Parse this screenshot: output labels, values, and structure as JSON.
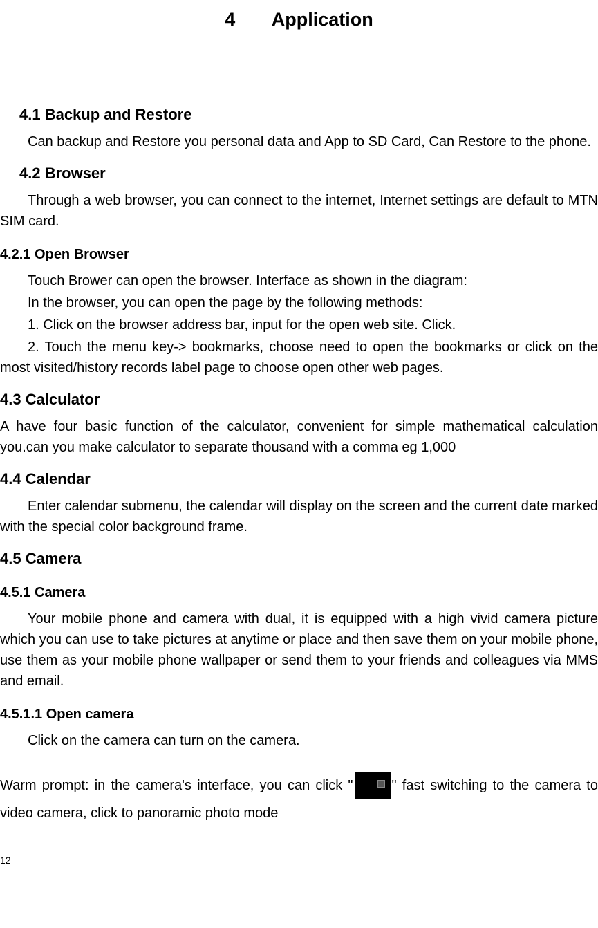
{
  "chapter": {
    "number": "4",
    "title": "Application"
  },
  "sections": {
    "s41": {
      "heading": "4.1    Backup and Restore",
      "body": "Can backup and Restore you personal data and App to SD Card, Can Restore to the phone."
    },
    "s42": {
      "heading": "4.2       Browser",
      "body": "Through a web browser, you can connect to the internet, Internet settings are default to MTN SIM card."
    },
    "s421": {
      "heading": "4.2.1    Open Browser",
      "p1": "Touch Brower can open the browser. Interface as shown in the diagram:",
      "p2": "In the browser, you can open the page by the following methods:",
      "p3": "1. Click on the browser address bar, input for the open web site. Click.",
      "p4": "2. Touch the menu key-> bookmarks, choose need to open the bookmarks or click on the most visited/history records label page to choose open other web pages."
    },
    "s43": {
      "heading": "4.3   Calculator",
      "body": "A have four basic function of the calculator, convenient for simple mathematical calculation you.can you make calculator to separate thousand with a comma eg 1,000"
    },
    "s44": {
      "heading": "4.4   Calendar",
      "body": "Enter calendar submenu, the calendar will display on the screen and the current date marked with the special color background frame."
    },
    "s45": {
      "heading": "4.5   Camera"
    },
    "s451": {
      "heading": "4.5.1    Camera",
      "body": "Your mobile phone and camera with dual, it is equipped with a high vivid camera picture which you can use to take pictures at anytime or place and then save them on your mobile phone, use them as your mobile phone wallpaper or send them to your friends and colleagues via MMS and email."
    },
    "s4511": {
      "heading": "4.5.1.1   Open camera",
      "p1": "Click on the camera can turn on the camera.",
      "p2_before": "Warm prompt: in the camera's interface, you can click \"",
      "p2_after": "\" fast switching to the camera to video camera, click to panoramic photo mode"
    }
  },
  "page_number": "12"
}
